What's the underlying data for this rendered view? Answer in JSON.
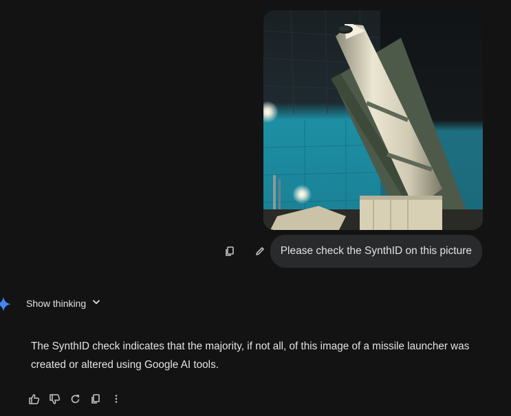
{
  "user_message": {
    "image": "missile-launcher-photo",
    "text": "Please check the SynthID on this picture",
    "actions": [
      "copy-icon",
      "edit-icon"
    ]
  },
  "assistant": {
    "logo": "gemini-sparkle-icon",
    "show_thinking_label": "Show thinking",
    "response_text": "The SynthID check indicates that the majority, if not all, of this image of a missile launcher was created or altered using Google AI tools.",
    "actions": [
      "thumbs-up-icon",
      "thumbs-down-icon",
      "regenerate-icon",
      "copy-icon",
      "more-vert-icon"
    ]
  },
  "colors": {
    "background": "#131314",
    "bubble": "#282a2c",
    "text": "#e3e3e3",
    "icon": "#c4c7c5",
    "accent": "#4285f4"
  }
}
